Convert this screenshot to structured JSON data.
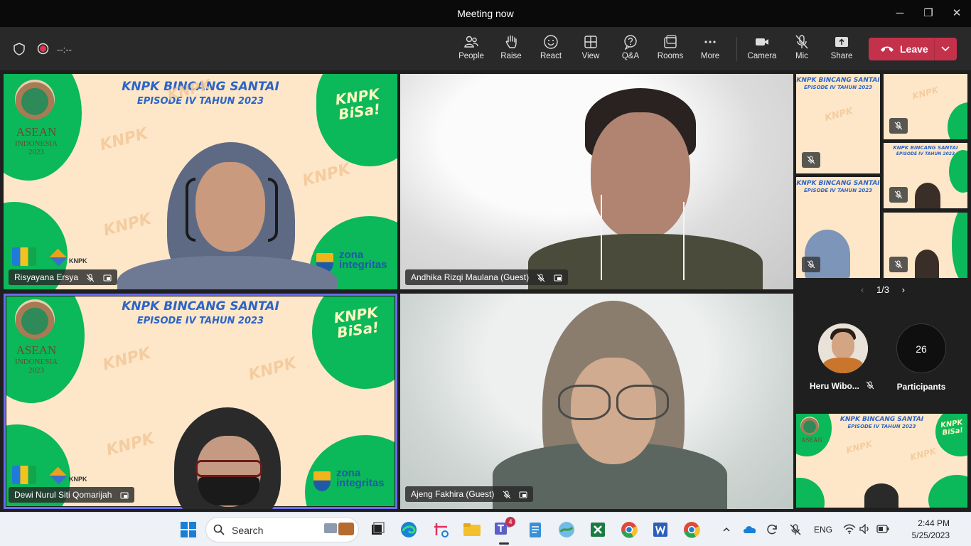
{
  "window": {
    "title": "Meeting now",
    "minimize": "─",
    "maximize": "❐",
    "close": "✕"
  },
  "toolbar": {
    "timer": "--:--",
    "items": [
      {
        "label": "People",
        "icon": "people-icon"
      },
      {
        "label": "Raise",
        "icon": "hand-icon"
      },
      {
        "label": "React",
        "icon": "smile-icon"
      },
      {
        "label": "View",
        "icon": "grid-icon"
      },
      {
        "label": "Q&A",
        "icon": "qa-icon"
      },
      {
        "label": "Rooms",
        "icon": "rooms-icon"
      },
      {
        "label": "More",
        "icon": "more-icon"
      },
      {
        "label": "Camera",
        "icon": "camera-icon"
      },
      {
        "label": "Mic",
        "icon": "mic-off-icon"
      },
      {
        "label": "Share",
        "icon": "share-icon"
      }
    ],
    "leave_label": "Leave"
  },
  "slide": {
    "title_line1": "KNPK BINCANG SANTAI",
    "title_line2": "EPISODE IV TAHUN 2023",
    "badge_line1": "KNPK",
    "badge_line2": "BiSa!",
    "asean_line1": "ASEAN",
    "asean_line2": "INDONESIA",
    "asean_line3": "2023",
    "zona_line1": "zona",
    "zona_line2": "integritas",
    "knpk_logo": "KNPK",
    "watermark": "KNPK"
  },
  "tiles": [
    {
      "name": "Risyayana Ersya"
    },
    {
      "name": "Andhika Rizqi Maulana (Guest)"
    },
    {
      "name": "Dewi Nurul Siti Qomarijah"
    },
    {
      "name": "Ajeng Fakhira (Guest)"
    }
  ],
  "panel": {
    "pager": "1/3",
    "prev": "‹",
    "next": "›",
    "featured_name": "Heru Wibo...",
    "participants_count": "26",
    "participants_label": "Participants"
  },
  "taskbar": {
    "search_label": "Search",
    "teams_badge": "4",
    "lang": "ENG",
    "time": "2:44 PM",
    "date": "5/25/2023"
  },
  "colors": {
    "leave": "#c4314b",
    "selected_outline": "#6c6cf0",
    "slide_green": "#0bb85a",
    "slide_bg": "#fde7c8"
  }
}
